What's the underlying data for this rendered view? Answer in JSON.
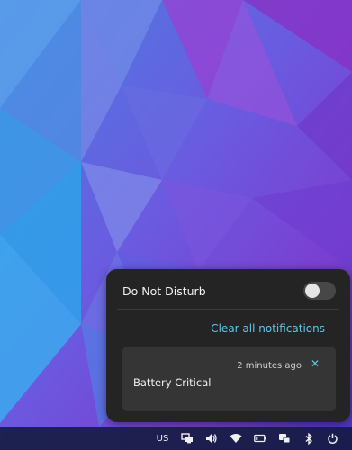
{
  "notification_panel": {
    "dnd_label": "Do Not Disturb",
    "dnd_enabled": false,
    "clear_label": "Clear all notifications",
    "notifications": [
      {
        "title": "Battery Critical",
        "time": "2 minutes ago",
        "close_glyph": "✕"
      }
    ]
  },
  "taskbar": {
    "keyboard_layout": "US",
    "tray_icons": [
      "display-icon",
      "volume-icon",
      "wifi-icon",
      "battery-icon",
      "keyboard-icon",
      "bluetooth-icon",
      "power-icon"
    ]
  },
  "colors": {
    "accent": "#62c4e6",
    "panel_bg": "#242424",
    "card_bg": "#353535"
  }
}
